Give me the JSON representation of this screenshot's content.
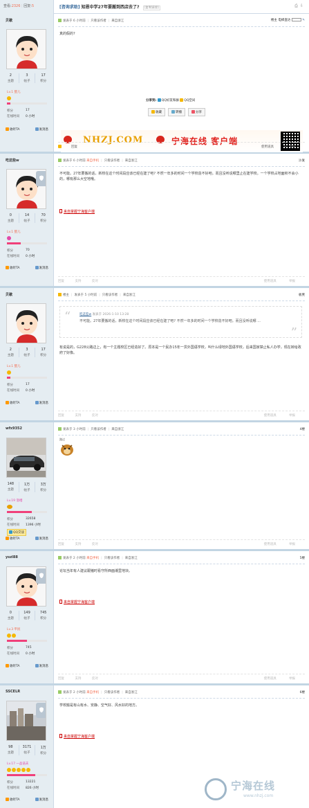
{
  "thread": {
    "views_label": "查看:",
    "views": "2326",
    "replies_label": "回复:",
    "replies": "5",
    "category": "[咨询求助]",
    "title": "知恩中学27年要搬到西店去了?",
    "copy_link": "[复制链接]"
  },
  "posts": [
    {
      "username": "贝歌",
      "stats": [
        {
          "num": "2",
          "label": "主题"
        },
        {
          "num": "3",
          "label": "帖子"
        },
        {
          "num": "17",
          "label": "积分"
        }
      ],
      "level": "Lv.1 婴儿",
      "stars": 1,
      "level_progress": 0.08,
      "points_label": "积分",
      "points": "17",
      "online_label": "在线时间",
      "online": "0 小时",
      "follow": "收听TA",
      "message": "发消息",
      "header": {
        "posted": "发表于 6 小时前",
        "author_only": "只看该作者",
        "from": "来自浙江",
        "floor": "楼主",
        "reading_mode": "电梯直达"
      },
      "text": "真的假的?",
      "share_label": "分享到:",
      "share_qzone": "QQ好友和群",
      "share_qq": "QQ空间",
      "buttons": [
        "收藏",
        "转播",
        "分享"
      ],
      "banner_site": "NHZJ.COM",
      "banner_slogan": "宁海在线 客户端",
      "footer": {
        "reply": "回复",
        "manage": "使用道具",
        "report": "举报"
      }
    },
    {
      "username": "吃这些w",
      "stats": [
        {
          "num": "0",
          "label": "主题"
        },
        {
          "num": "14",
          "label": "帖子"
        },
        {
          "num": "70",
          "label": "积分"
        }
      ],
      "level": "Lv.1 婴儿",
      "stars": 1,
      "level_progress": 0.35,
      "points_label": "积分",
      "points": "70",
      "online_label": "在线时间",
      "online": "0 小时",
      "follow": "收听TA",
      "message": "发消息",
      "header": {
        "posted": "发表于 6 小时前",
        "mobile": "来自手机",
        "author_only": "只看该作者",
        "from": "来自浙江",
        "floor": "沙发"
      },
      "text": "不可能。27年要搬的话，新校在这个时间段应该已经在建了吧? 不然一年多的时间一个学校造不好吧。而且没听说哪里止在建学校。一个学校占地面积不会小的，哪有那么大空地哦。",
      "mobile_link": "来自掌握宁海客户端",
      "footer": {
        "reply": "回复",
        "support": "支持",
        "oppose": "反对",
        "manage": "使用道具",
        "report": "举报"
      }
    },
    {
      "username": "贝歌",
      "stats": [
        {
          "num": "2",
          "label": "主题"
        },
        {
          "num": "3",
          "label": "帖子"
        },
        {
          "num": "17",
          "label": "积分"
        }
      ],
      "level": "Lv.1 婴儿",
      "stars": 1,
      "level_progress": 0.08,
      "points_label": "积分",
      "points": "17",
      "online_label": "在线时间",
      "online": "0 小时",
      "follow": "收听TA",
      "message": "发消息",
      "header": {
        "poster_tag": "楼主",
        "posted": "发表于 5 小时前",
        "author_only": "只看该作者",
        "from": "来自浙江",
        "floor": "板凳"
      },
      "quote": {
        "author": "吃这些w",
        "posted": "发表于 2026-1-10 13:28",
        "body": "不可能。27年要搬的话，新校在这个时间段应该已经在建了吧? 不然一年多的时间一个学校造不好吧。而且没听说哪 ..."
      },
      "text": "有说是的，G228公路边上，有一个主题校区已经造好了。原本是一个民办15年一贯外国语学校，叫什么绿地外国语学校，后来国家禁止私人办学，现在转给政府了好像。",
      "footer": {
        "reply": "回复",
        "support": "支持",
        "oppose": "反对",
        "manage": "使用道具",
        "report": "举报"
      }
    },
    {
      "username": "wfx9352",
      "stats": [
        {
          "num": "148",
          "label": "主题"
        },
        {
          "num": "1万",
          "label": "帖子"
        },
        {
          "num": "3万",
          "label": "积分"
        }
      ],
      "level": "Lv.19 浴相",
      "stars": 0,
      "level_progress": 0.62,
      "points_label": "积分",
      "points": "32658",
      "online_label": "在线时间",
      "online": "1396 小时",
      "qq": "QQ交谈",
      "follow": "收听TA",
      "message": "发消息",
      "header": {
        "posted": "发表于 3 小时前",
        "author_only": "只看该作者",
        "from": "来自浙江",
        "floor": "4楼"
      },
      "emoji_caption": "路过",
      "footer": {
        "reply": "回复",
        "support": "支持",
        "oppose": "反对",
        "manage": "使用道具",
        "report": "举报"
      }
    },
    {
      "username": "yszl88",
      "stats": [
        {
          "num": "0",
          "label": "主题"
        },
        {
          "num": "149",
          "label": "帖子"
        },
        {
          "num": "745",
          "label": "积分"
        }
      ],
      "level": "Lv.3 平民",
      "stars": 2,
      "level_progress": 0.5,
      "points_label": "积分",
      "points": "745",
      "online_label": "在线时间",
      "online": "0 小时",
      "follow": "收听TA",
      "message": "发消息",
      "header": {
        "posted": "发表于 2 小时前",
        "mobile": "来自手机",
        "author_only": "只看该作者",
        "from": "来自浙江",
        "floor": "5楼"
      },
      "text": "论坛当年有人建议跟猪时看守所西面潮里地块。",
      "mobile_link": "来自掌握宁海客户端",
      "footer": {
        "reply": "回复",
        "support": "支持",
        "oppose": "反对",
        "manage": "使用道具",
        "report": "举报"
      }
    },
    {
      "username": "SSCELR",
      "stats": [
        {
          "num": "98",
          "label": "主题"
        },
        {
          "num": "3171",
          "label": "帖子"
        },
        {
          "num": "1万",
          "label": "积分"
        }
      ],
      "level": "Lv.17 一品诰夫",
      "stars": 5,
      "level_progress": 0.7,
      "points_label": "积分",
      "points": "13221",
      "online_label": "在线时间",
      "online": "826 小时",
      "follow": "收听TA",
      "message": "发消息",
      "header": {
        "posted": "发表于 2 小时前",
        "mobile": "来自手机",
        "author_only": "只看该作者",
        "from": "来自浙江",
        "floor": "6楼"
      },
      "text": "学校搬是有山有水、安静、空气好、风水好的地方。",
      "mobile_link": "来自掌握宁海客户端"
    }
  ],
  "watermark": {
    "name": "宁海在线",
    "url": "www.nhzj.com"
  },
  "colors": {
    "sidebar": "#e5edf2",
    "border": "#c2d5e3",
    "accent_red": "#f26c4f",
    "link_blue": "#336699"
  }
}
